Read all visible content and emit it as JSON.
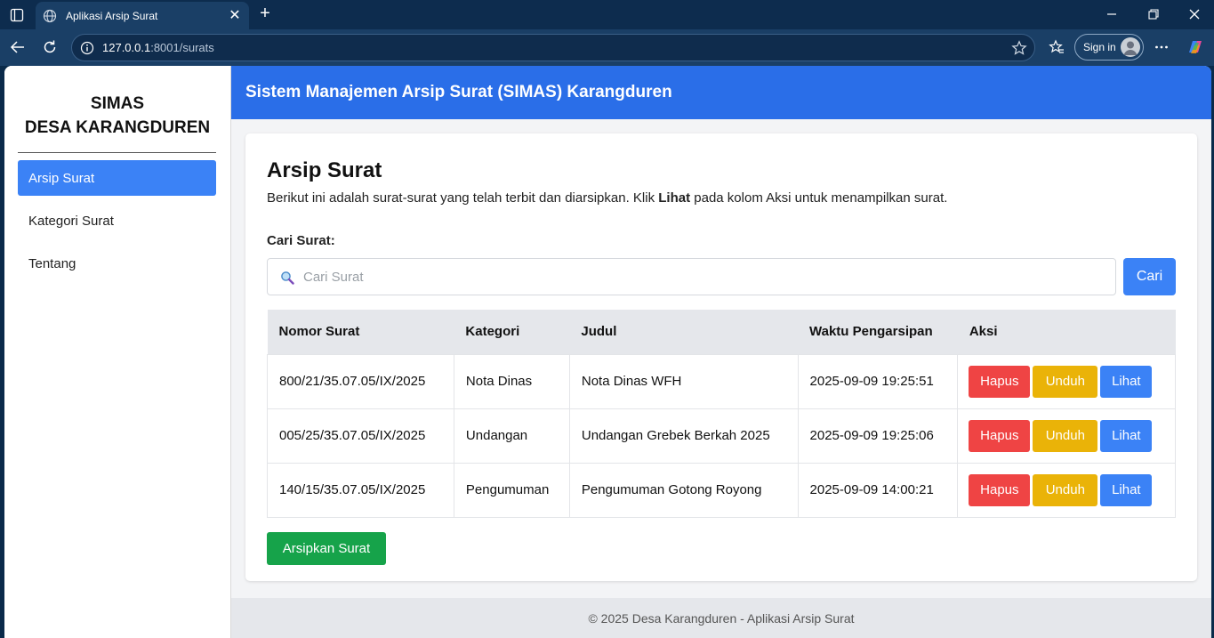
{
  "browser": {
    "tab_title": "Aplikasi Arsip Surat",
    "url_host": "127.0.0.1",
    "url_rest": ":8001/surats",
    "signin_label": "Sign in"
  },
  "sidebar": {
    "brand_line1": "SIMAS",
    "brand_line2": "DESA KARANGDUREN",
    "items": [
      {
        "label": "Arsip Surat",
        "active": true
      },
      {
        "label": "Kategori Surat",
        "active": false
      },
      {
        "label": "Tentang",
        "active": false
      }
    ]
  },
  "header": {
    "title": "Sistem Manajemen Arsip Surat (SIMAS) Karangduren"
  },
  "main": {
    "page_title": "Arsip Surat",
    "desc_before": "Berikut ini adalah surat-surat yang telah terbit dan diarsipkan. Klik ",
    "desc_bold": "Lihat",
    "desc_after": " pada kolom Aksi untuk menampilkan surat.",
    "search_label": "Cari Surat:",
    "search_placeholder": "Cari Surat",
    "search_button": "Cari",
    "table": {
      "headers": [
        "Nomor Surat",
        "Kategori",
        "Judul",
        "Waktu Pengarsipan",
        "Aksi"
      ],
      "rows": [
        {
          "nomor": "800/21/35.07.05/IX/2025",
          "kategori": "Nota Dinas",
          "judul": "Nota Dinas WFH",
          "waktu": "2025-09-09 19:25:51"
        },
        {
          "nomor": "005/25/35.07.05/IX/2025",
          "kategori": "Undangan",
          "judul": "Undangan Grebek Berkah 2025",
          "waktu": "2025-09-09 19:25:06"
        },
        {
          "nomor": "140/15/35.07.05/IX/2025",
          "kategori": "Pengumuman",
          "judul": "Pengumuman Gotong Royong",
          "waktu": "2025-09-09 14:00:21"
        }
      ],
      "actions": {
        "delete": "Hapus",
        "download": "Unduh",
        "view": "Lihat"
      }
    },
    "archive_button": "Arsipkan Surat"
  },
  "footer": {
    "text": "© 2025 Desa Karangduren - Aplikasi Arsip Surat"
  },
  "colors": {
    "header_bg": "#2a6ee8",
    "primary": "#3b82f6",
    "danger": "#ef4444",
    "warning": "#eab308",
    "success": "#16a34a"
  }
}
